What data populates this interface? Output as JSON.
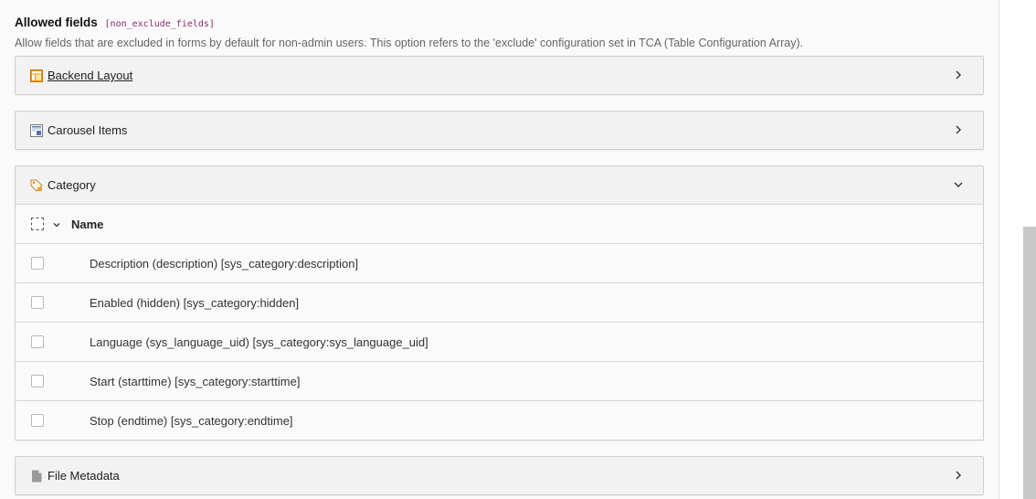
{
  "header": {
    "title": "Allowed fields",
    "code": "[non_exclude_fields]",
    "description": "Allow fields that are excluded in forms by default for non-admin users. This option refers to the 'exclude' configuration set in TCA (Table Configuration Array)."
  },
  "panels": [
    {
      "label": "Backend Layout",
      "icon": "backend-layout-icon",
      "expanded": false
    },
    {
      "label": "Carousel Items",
      "icon": "carousel-items-icon",
      "expanded": false
    },
    {
      "label": "Category",
      "icon": "category-icon",
      "expanded": true
    },
    {
      "label": "File Metadata",
      "icon": "file-metadata-icon",
      "expanded": false
    }
  ],
  "category_table": {
    "column_header": "Name",
    "rows": [
      {
        "label": "Description (description) [sys_category:description]",
        "checked": false
      },
      {
        "label": "Enabled (hidden) [sys_category:hidden]",
        "checked": false
      },
      {
        "label": "Language (sys_language_uid) [sys_category:sys_language_uid]",
        "checked": false
      },
      {
        "label": "Start (starttime) [sys_category:starttime]",
        "checked": false
      },
      {
        "label": "Stop (endtime) [sys_category:endtime]",
        "checked": false
      }
    ]
  },
  "colors": {
    "code": "#8e2d6a",
    "backend_layout_icon": "#f49700",
    "carousel_icon": "#4a7ab4"
  }
}
